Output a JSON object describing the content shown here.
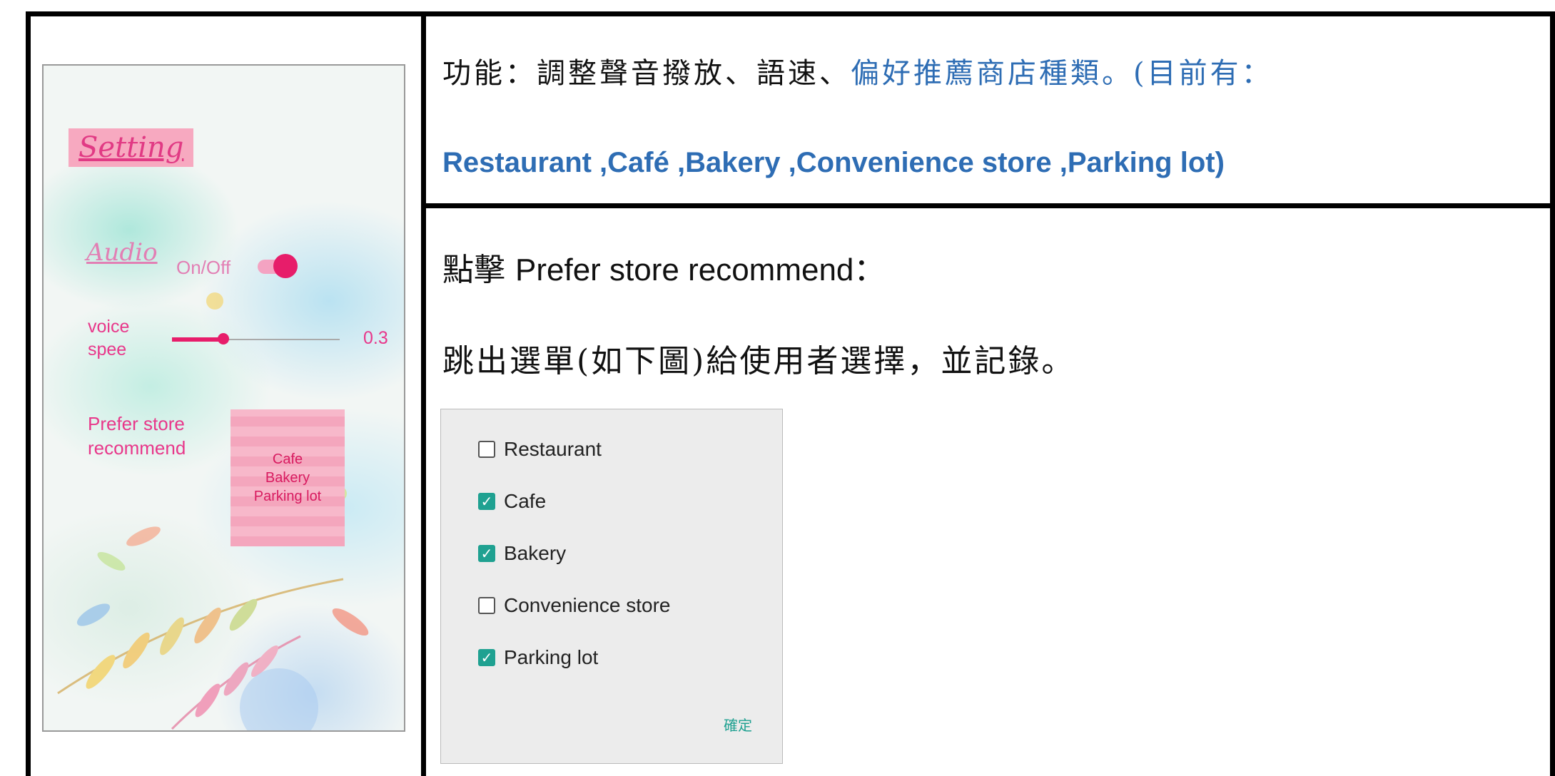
{
  "phone": {
    "title": "Setting",
    "audio_label": "Audio",
    "onoff_label": "On/Off",
    "voice_label_1": "voice",
    "voice_label_2": "spee",
    "voice_speed_value": "0.3",
    "voice_speed_fraction": 0.3,
    "prefer_label_1": "Prefer store",
    "prefer_label_2": "recommend",
    "prefer_items": [
      "Cafe",
      "Bakery",
      "Parking lot"
    ],
    "accent_color": "#e71d6a"
  },
  "description": {
    "line1_black": "功能：調整聲音撥放、語速、",
    "line1_blue": "偏好推薦商店種類。(目前有：",
    "line2_blue": "Restaurant ,Café ,Bakery ,Convenience store ,Parking lot)",
    "click_prefix": "點擊 ",
    "click_en": "Prefer store recommend",
    "click_suffix": "：",
    "popup_line": "跳出選單(如下圖)給使用者選擇，並記錄。",
    "blue_color": "#2e6db4"
  },
  "dialog": {
    "options": [
      {
        "label": "Restaurant",
        "checked": false
      },
      {
        "label": "Cafe",
        "checked": true
      },
      {
        "label": "Bakery",
        "checked": true
      },
      {
        "label": "Convenience store",
        "checked": false
      },
      {
        "label": "Parking lot",
        "checked": true
      }
    ],
    "confirm_label": "確定",
    "check_color": "#1fa191"
  }
}
